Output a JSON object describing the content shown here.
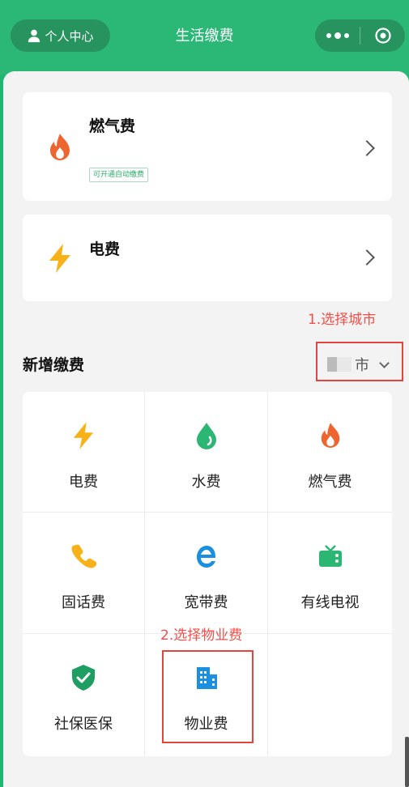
{
  "header": {
    "profile_label": "个人中心",
    "title": "生活缴费",
    "more_icon": "more-dots-icon",
    "close_icon": "target-icon"
  },
  "bills": [
    {
      "name": "燃气费",
      "badge": "可开通自动缴费",
      "icon": "flame-icon",
      "color": "#ef6530"
    },
    {
      "name": "电费",
      "icon": "lightning-icon",
      "color": "#f7b21a"
    }
  ],
  "annotations": {
    "step1": "1.选择城市",
    "step2": "2.选择物业费"
  },
  "new_payment": {
    "title": "新增缴费",
    "city_suffix": "市"
  },
  "services": [
    {
      "label": "电费",
      "icon": "lightning-icon",
      "color": "#f7b21a"
    },
    {
      "label": "水费",
      "icon": "water-drop-icon",
      "color": "#2bb673"
    },
    {
      "label": "燃气费",
      "icon": "flame-icon",
      "color": "#ef6530"
    },
    {
      "label": "固话费",
      "icon": "phone-icon",
      "color": "#f7b21a"
    },
    {
      "label": "宽带费",
      "icon": "browser-e-icon",
      "color": "#1b8fe0"
    },
    {
      "label": "有线电视",
      "icon": "tv-icon",
      "color": "#2bb673"
    },
    {
      "label": "社保医保",
      "icon": "shield-check-icon",
      "color": "#1e9e62"
    },
    {
      "label": "物业费",
      "icon": "building-icon",
      "color": "#1b8fe0"
    }
  ]
}
